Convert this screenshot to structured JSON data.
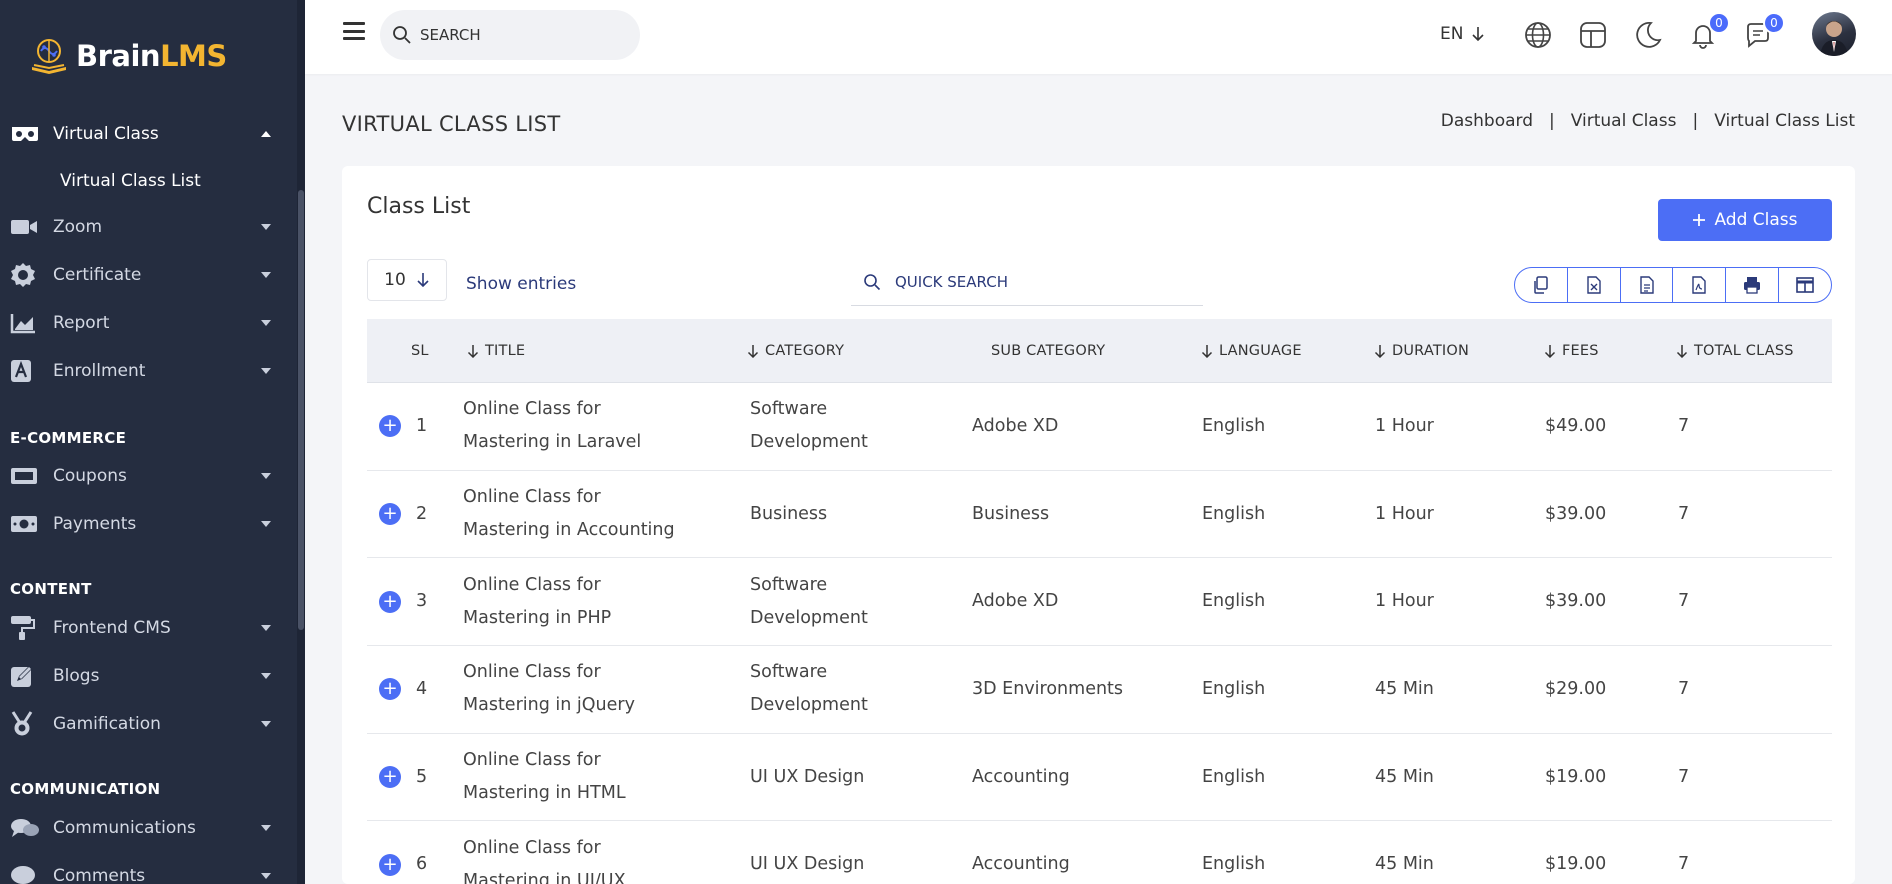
{
  "brand": {
    "part1": "Brain",
    "part2": "LMS"
  },
  "sidebar": {
    "items": [
      {
        "label": "Virtual Class",
        "icon": "vr-headset-icon"
      },
      {
        "label": "Zoom",
        "icon": "video-camera-icon"
      },
      {
        "label": "Certificate",
        "icon": "certificate-icon"
      },
      {
        "label": "Report",
        "icon": "chart-icon"
      },
      {
        "label": "Enrollment",
        "icon": "enrollment-icon"
      },
      {
        "label": "Coupons",
        "icon": "coupon-icon"
      },
      {
        "label": "Payments",
        "icon": "money-icon"
      },
      {
        "label": "Frontend CMS",
        "icon": "paint-roller-icon"
      },
      {
        "label": "Blogs",
        "icon": "blog-icon"
      },
      {
        "label": "Gamification",
        "icon": "medal-icon"
      },
      {
        "label": "Communications",
        "icon": "chat-icon"
      },
      {
        "label": "Comments",
        "icon": "comment-icon"
      }
    ],
    "sub_item": "Virtual Class List",
    "sections": {
      "ecommerce": "E-COMMERCE",
      "content": "CONTENT",
      "communication": "COMMUNICATION"
    }
  },
  "topbar": {
    "search_placeholder": "SEARCH",
    "language": "EN",
    "notifications_count": "0",
    "messages_count": "0"
  },
  "page": {
    "title": "VIRTUAL CLASS LIST",
    "breadcrumb": [
      "Dashboard",
      "Virtual Class",
      "Virtual Class List"
    ],
    "breadcrumb_sep": "|"
  },
  "card": {
    "title": "Class List",
    "add_button": "Add Class",
    "entries_value": "10",
    "entries_label": "Show entries",
    "quick_search_placeholder": "QUICK SEARCH"
  },
  "table": {
    "headers": [
      "SL",
      "TITLE",
      "CATEGORY",
      "SUB CATEGORY",
      "LANGUAGE",
      "DURATION",
      "FEES",
      "TOTAL CLASS"
    ],
    "rows": [
      {
        "sl": "1",
        "title1": "Online Class for",
        "title2": "Mastering in Laravel",
        "cat1": "Software",
        "cat2": "Development",
        "sub": "Adobe XD",
        "lang": "English",
        "dur": "1 Hour",
        "fees": "$49.00",
        "total": "7"
      },
      {
        "sl": "2",
        "title1": "Online Class for",
        "title2": "Mastering in Accounting",
        "cat1": "Business",
        "cat2": "",
        "sub": "Business",
        "lang": "English",
        "dur": "1 Hour",
        "fees": "$39.00",
        "total": "7"
      },
      {
        "sl": "3",
        "title1": "Online Class for",
        "title2": "Mastering in PHP",
        "cat1": "Software",
        "cat2": "Development",
        "sub": "Adobe XD",
        "lang": "English",
        "dur": "1 Hour",
        "fees": "$39.00",
        "total": "7"
      },
      {
        "sl": "4",
        "title1": "Online Class for",
        "title2": "Mastering in jQuery",
        "cat1": "Software",
        "cat2": "Development",
        "sub": "3D Environments",
        "lang": "English",
        "dur": "45 Min",
        "fees": "$29.00",
        "total": "7"
      },
      {
        "sl": "5",
        "title1": "Online Class for",
        "title2": "Mastering in HTML",
        "cat1": "UI UX Design",
        "cat2": "",
        "sub": "Accounting",
        "lang": "English",
        "dur": "45 Min",
        "fees": "$19.00",
        "total": "7"
      },
      {
        "sl": "6",
        "title1": "Online Class for",
        "title2": "Mastering in UI/UX",
        "cat1": "UI UX Design",
        "cat2": "",
        "sub": "Accounting",
        "lang": "English",
        "dur": "45 Min",
        "fees": "$19.00",
        "total": "7"
      }
    ]
  },
  "colors": {
    "sidebar_bg": "#252d40",
    "accent": "#4c6ef5",
    "logo_accent": "#f3b531"
  }
}
